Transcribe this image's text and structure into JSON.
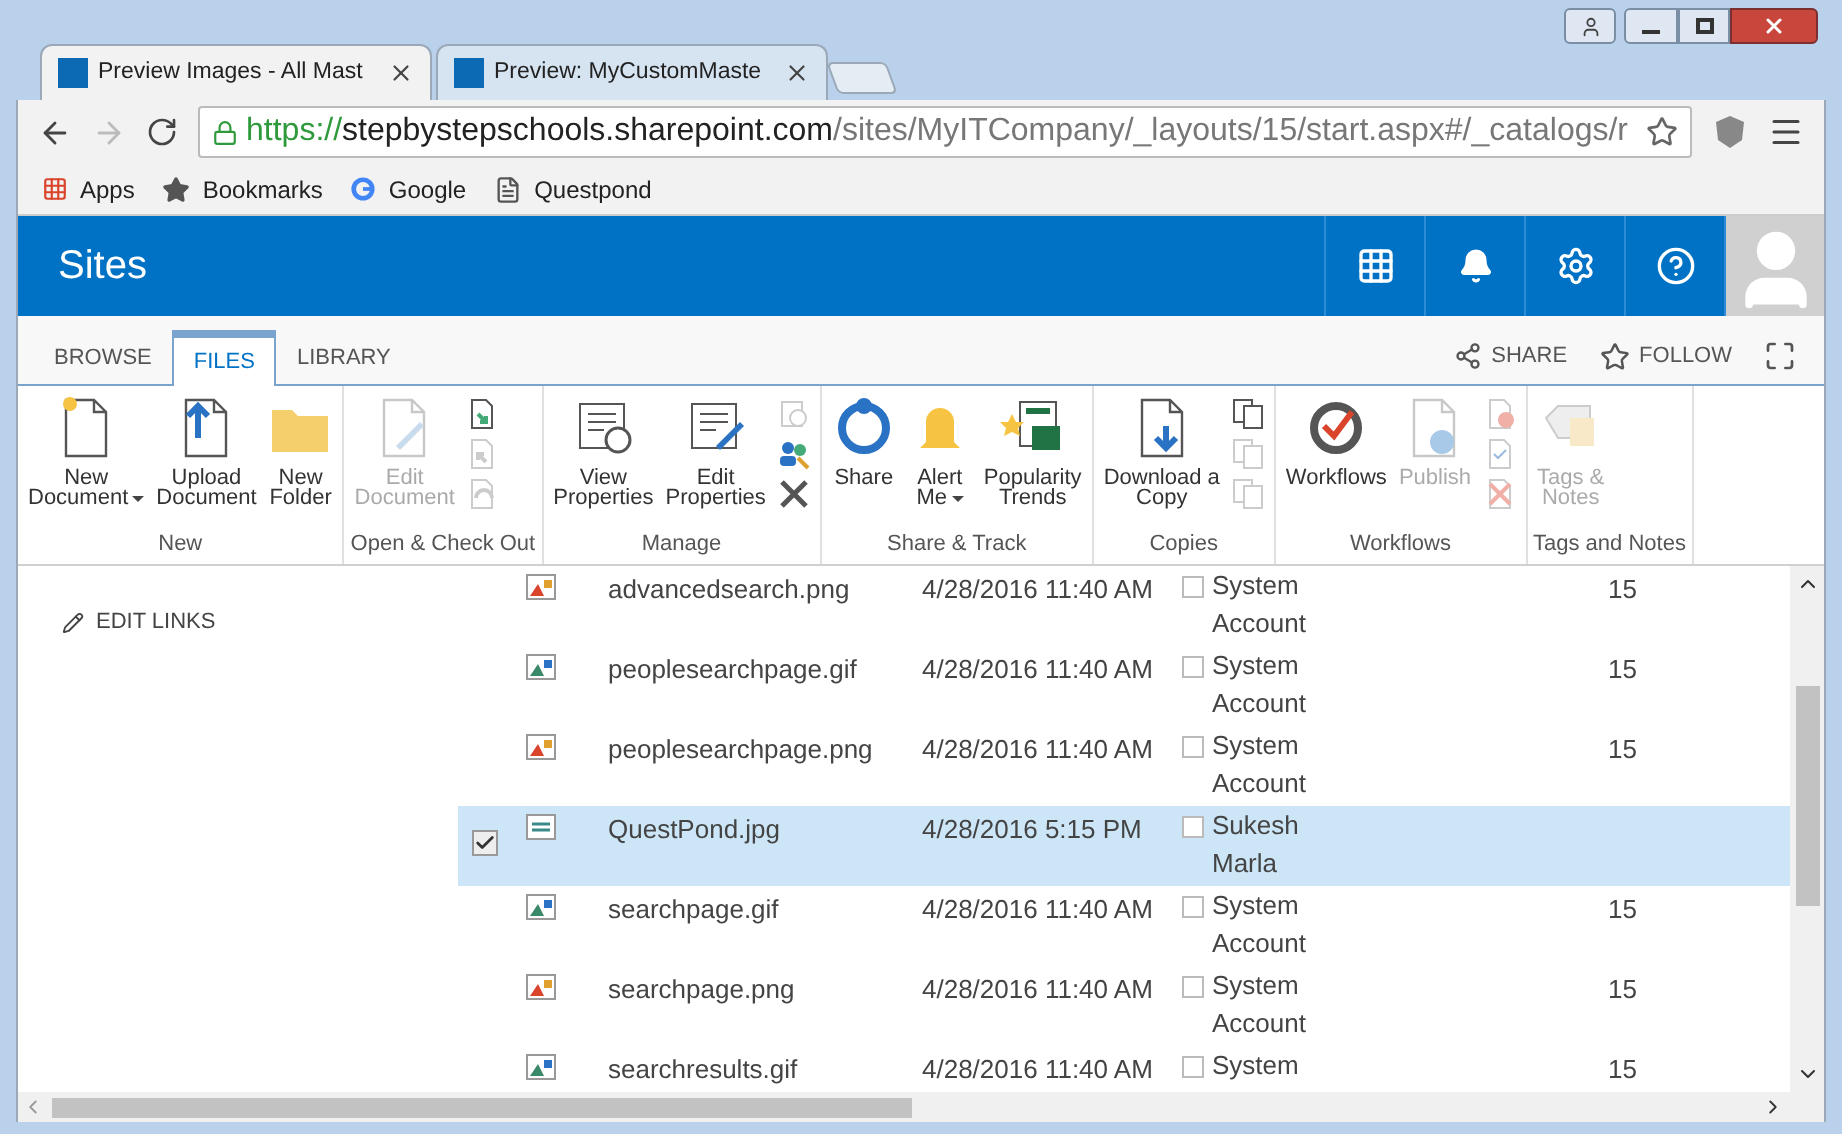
{
  "browser": {
    "tabs": [
      {
        "title": "Preview Images - All Mast",
        "selected": true
      },
      {
        "title": "Preview: MyCustomMaste",
        "selected": false
      }
    ],
    "url": {
      "scheme": "https://",
      "host": "stepbystepschools.sharepoint.com",
      "path": "/sites/MyITCompany/_layouts/15/start.aspx#/_catalogs/r"
    },
    "bookmarks": [
      {
        "label": "Apps",
        "kind": "apps"
      },
      {
        "label": "Bookmarks",
        "kind": "star"
      },
      {
        "label": "Google",
        "kind": "google"
      },
      {
        "label": "Questpond",
        "kind": "page"
      }
    ]
  },
  "suite_bar": {
    "title": "Sites"
  },
  "ribbon": {
    "tabs": [
      {
        "label": "BROWSE",
        "selected": false
      },
      {
        "label": "FILES",
        "selected": true
      },
      {
        "label": "LIBRARY",
        "selected": false
      }
    ],
    "actions": [
      {
        "label": "SHARE",
        "kind": "share"
      },
      {
        "label": "FOLLOW",
        "kind": "follow"
      }
    ],
    "groups": [
      {
        "label": "New",
        "buttons": [
          {
            "lines": [
              "New",
              "Document"
            ],
            "kind": "new-doc",
            "dropdown": true,
            "disabled": false
          },
          {
            "lines": [
              "Upload",
              "Document"
            ],
            "kind": "upload",
            "dropdown": false,
            "disabled": false
          },
          {
            "lines": [
              "New",
              "Folder"
            ],
            "kind": "folder",
            "dropdown": false,
            "disabled": false
          }
        ]
      },
      {
        "label": "Open & Check Out",
        "buttons": [
          {
            "lines": [
              "Edit",
              "Document"
            ],
            "kind": "edit-doc",
            "dropdown": false,
            "disabled": true
          }
        ],
        "small": [
          {
            "kind": "check-in",
            "disabled": false
          },
          {
            "kind": "check-out",
            "disabled": true
          },
          {
            "kind": "discard",
            "disabled": true
          }
        ]
      },
      {
        "label": "Manage",
        "buttons": [
          {
            "lines": [
              "View",
              "Properties"
            ],
            "kind": "view-props",
            "dropdown": false,
            "disabled": false
          },
          {
            "lines": [
              "Edit",
              "Properties"
            ],
            "kind": "edit-props",
            "dropdown": false,
            "disabled": false
          }
        ],
        "small": [
          {
            "kind": "history",
            "disabled": true
          },
          {
            "kind": "people",
            "disabled": false
          },
          {
            "kind": "delete",
            "disabled": false
          }
        ]
      },
      {
        "label": "Share & Track",
        "buttons": [
          {
            "lines": [
              "Share"
            ],
            "kind": "share",
            "dropdown": false,
            "disabled": false
          },
          {
            "lines": [
              "Alert",
              "Me"
            ],
            "kind": "alert",
            "dropdown": true,
            "disabled": false
          },
          {
            "lines": [
              "Popularity",
              "Trends"
            ],
            "kind": "trends",
            "dropdown": false,
            "disabled": false
          }
        ]
      },
      {
        "label": "Copies",
        "buttons": [
          {
            "lines": [
              "Download a",
              "Copy"
            ],
            "kind": "download",
            "dropdown": false,
            "disabled": false
          }
        ],
        "small": [
          {
            "kind": "copy",
            "disabled": false
          },
          {
            "kind": "copy",
            "disabled": true
          },
          {
            "kind": "copy",
            "disabled": true
          }
        ]
      },
      {
        "label": "Workflows",
        "buttons": [
          {
            "lines": [
              "Workflows"
            ],
            "kind": "workflows",
            "dropdown": false,
            "disabled": false
          },
          {
            "lines": [
              "Publish"
            ],
            "kind": "publish",
            "dropdown": false,
            "disabled": true
          }
        ],
        "small": [
          {
            "kind": "unpublish",
            "disabled": true
          },
          {
            "kind": "approve",
            "disabled": true
          },
          {
            "kind": "reject",
            "disabled": true
          }
        ]
      },
      {
        "label": "Tags and Notes",
        "buttons": [
          {
            "lines": [
              "Tags &",
              "Notes"
            ],
            "kind": "tags",
            "dropdown": false,
            "disabled": true
          }
        ]
      }
    ]
  },
  "nav": {
    "edit_links": "EDIT LINKS"
  },
  "list": {
    "rows": [
      {
        "selected": false,
        "kind": "png",
        "name": "advancedsearch.png",
        "modified": "4/28/2016 11:40 AM",
        "flag_checked": false,
        "modified_by": "System Account",
        "version": "15"
      },
      {
        "selected": false,
        "kind": "gif",
        "name": "peoplesearchpage.gif",
        "modified": "4/28/2016 11:40 AM",
        "flag_checked": false,
        "modified_by": "System Account",
        "version": "15"
      },
      {
        "selected": false,
        "kind": "png",
        "name": "peoplesearchpage.png",
        "modified": "4/28/2016 11:40 AM",
        "flag_checked": false,
        "modified_by": "System Account",
        "version": "15"
      },
      {
        "selected": true,
        "kind": "jpg",
        "name": "QuestPond.jpg",
        "modified": "4/28/2016 5:15 PM",
        "flag_checked": false,
        "modified_by": "Sukesh Marla"
      },
      {
        "selected": false,
        "kind": "gif",
        "name": "searchpage.gif",
        "modified": "4/28/2016 11:40 AM",
        "flag_checked": false,
        "modified_by": "System Account",
        "version": "15"
      },
      {
        "selected": false,
        "kind": "png",
        "name": "searchpage.png",
        "modified": "4/28/2016 11:40 AM",
        "flag_checked": false,
        "modified_by": "System Account",
        "version": "15"
      },
      {
        "selected": false,
        "kind": "gif",
        "name": "searchresults.gif",
        "modified": "4/28/2016 11:40 AM",
        "flag_checked": false,
        "modified_by": "System",
        "version": "15"
      }
    ]
  }
}
